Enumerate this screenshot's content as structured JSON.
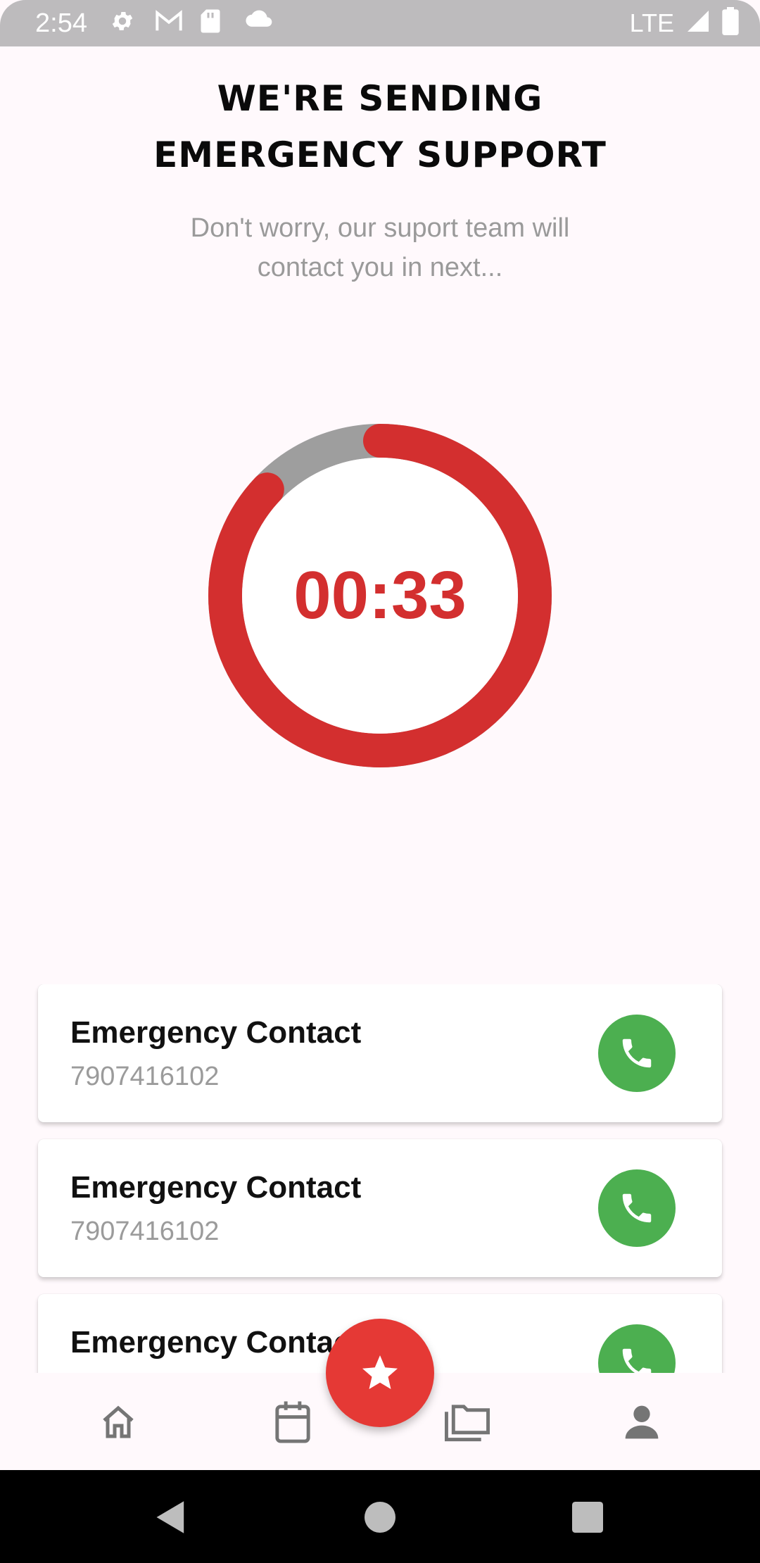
{
  "status_bar": {
    "time": "2:54",
    "network": "LTE",
    "icons": [
      "settings-icon",
      "gmail-icon",
      "sd-card-icon",
      "cloud-icon",
      "signal-icon",
      "battery-icon"
    ]
  },
  "header": {
    "title_line1": "WE'RE SENDING",
    "title_line2": "EMERGENCY SUPPORT",
    "subtitle": "Don't worry, our suport team will contact you in next..."
  },
  "timer": {
    "value": "00:33",
    "progress": 0.87,
    "colors": {
      "active": "#D32F2F",
      "track": "#9E9E9E"
    }
  },
  "contacts": [
    {
      "name": "Emergency Contact",
      "phone": "7907416102"
    },
    {
      "name": "Emergency Contact",
      "phone": "7907416102"
    },
    {
      "name": "Emergency Contact",
      "phone": ""
    }
  ],
  "bottom_nav": {
    "items": [
      "home-icon",
      "calendar-icon",
      "star-icon",
      "folder-icon",
      "person-icon"
    ],
    "fab_color": "#E53935"
  },
  "colors": {
    "call": "#4CAF50",
    "accent": "#D32F2F"
  }
}
